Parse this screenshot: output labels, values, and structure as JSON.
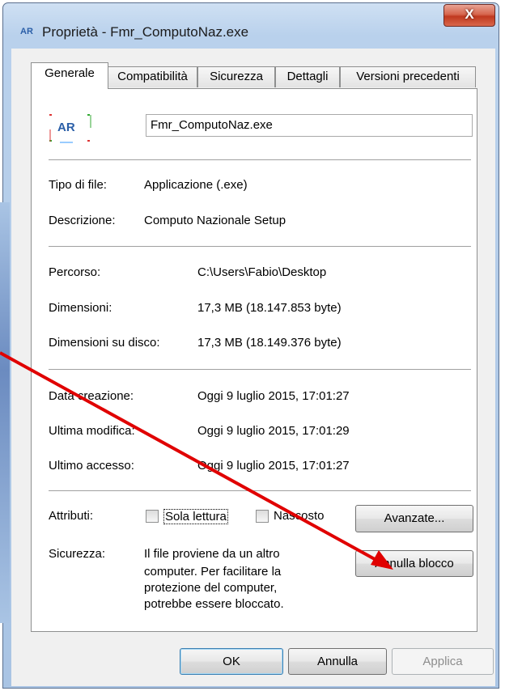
{
  "window": {
    "title": "Proprietà - Fmr_ComputoNaz.exe",
    "close_glyph": "X"
  },
  "tabs": [
    {
      "label": "Generale"
    },
    {
      "label": "Compatibilità"
    },
    {
      "label": "Sicurezza"
    },
    {
      "label": "Dettagli"
    },
    {
      "label": "Versioni precedenti"
    }
  ],
  "general": {
    "file_name": "Fmr_ComputoNaz.exe",
    "type_label": "Tipo di file:",
    "type_value": "Applicazione (.exe)",
    "desc_label": "Descrizione:",
    "desc_value": "Computo Nazionale Setup",
    "path_label": "Percorso:",
    "path_value": "C:\\Users\\Fabio\\Desktop",
    "size_label": "Dimensioni:",
    "size_value": "17,3 MB (18.147.853 byte)",
    "disk_label": "Dimensioni su disco:",
    "disk_value": "17,3 MB (18.149.376 byte)",
    "created_label": "Data creazione:",
    "created_value": "Oggi 9 luglio 2015, 17:01:27",
    "modified_label": "Ultima modifica:",
    "modified_value": "Oggi 9 luglio 2015, 17:01:29",
    "accessed_label": "Ultimo accesso:",
    "accessed_value": "Oggi 9 luglio 2015, 17:01:27",
    "attributes_label": "Attributi:",
    "readonly_label": "Sola lettura",
    "hidden_label": "Nascosto",
    "advanced_button": "Avanzate...",
    "security_label": "Sicurezza:",
    "security_text": [
      "Il file proviene da un altro",
      "computer. Per facilitare la",
      "protezione del computer,",
      "potrebbe essere bloccato."
    ],
    "unblock_button": "Annulla blocco"
  },
  "footer": {
    "ok": "OK",
    "cancel": "Annulla",
    "apply": "Applica"
  },
  "colors": {
    "arrow": "#e00000",
    "frame": "#b9d1ec",
    "close": "#c0391f"
  },
  "icons": {
    "title": "app-icon",
    "file": "app-icon"
  }
}
